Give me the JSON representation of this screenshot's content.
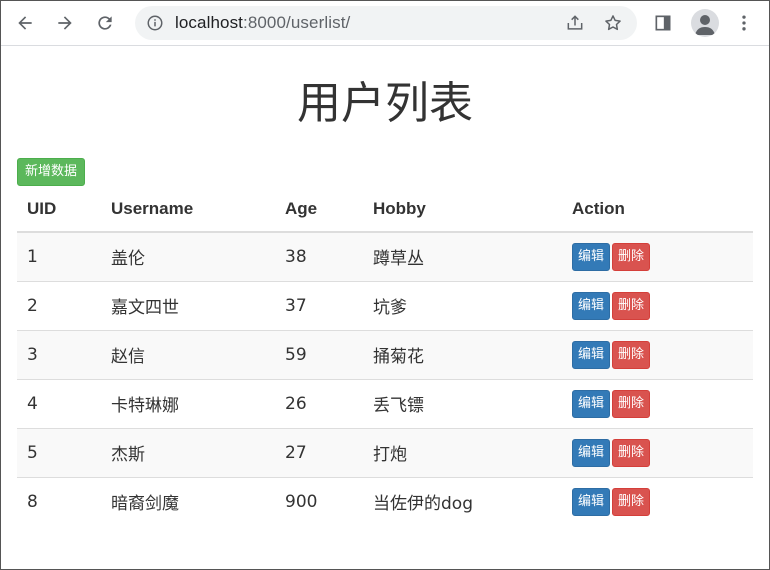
{
  "browser": {
    "url_host": "localhost",
    "url_rest": ":8000/userlist/"
  },
  "page": {
    "title": "用户列表",
    "add_button": "新增数据"
  },
  "table": {
    "headers": [
      "UID",
      "Username",
      "Age",
      "Hobby",
      "Action"
    ],
    "rows": [
      {
        "uid": "1",
        "username": "盖伦",
        "age": "38",
        "hobby": "蹲草丛"
      },
      {
        "uid": "2",
        "username": "嘉文四世",
        "age": "37",
        "hobby": "坑爹"
      },
      {
        "uid": "3",
        "username": "赵信",
        "age": "59",
        "hobby": "捅菊花"
      },
      {
        "uid": "4",
        "username": "卡特琳娜",
        "age": "26",
        "hobby": "丢飞镖"
      },
      {
        "uid": "5",
        "username": "杰斯",
        "age": "27",
        "hobby": "打炮"
      },
      {
        "uid": "8",
        "username": "暗裔剑魔",
        "age": "900",
        "hobby": "当佐伊的dog"
      }
    ],
    "edit_label": "编辑",
    "delete_label": "删除"
  },
  "colors": {
    "success": "#5cb85c",
    "primary": "#337ab7",
    "danger": "#d9534f"
  }
}
